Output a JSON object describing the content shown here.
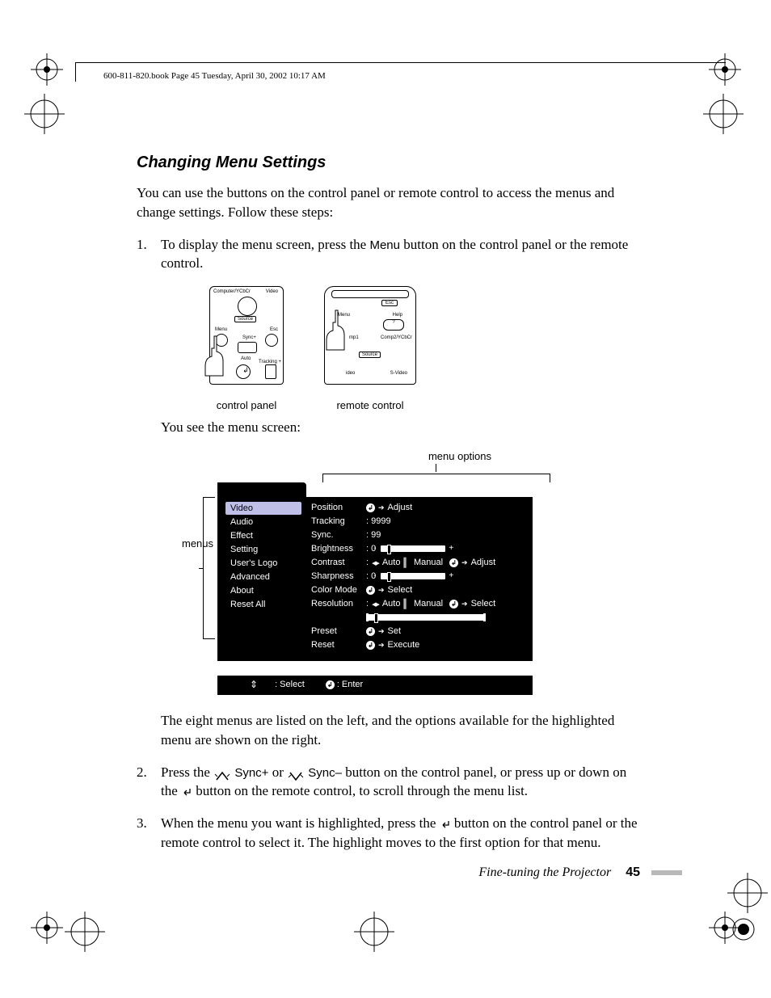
{
  "header": "600-811-820.book  Page 45  Tuesday, April 30, 2002  10:17 AM",
  "title": "Changing Menu Settings",
  "intro": "You can use the buttons on the control panel or remote control to access the menus and change settings. Follow these steps:",
  "step1_a": "To display the menu screen, press the ",
  "step1_menu": "Menu",
  "step1_b": " button on the control panel or the remote control.",
  "caption_cp": "control panel",
  "caption_rc": "remote control",
  "you_see": "You see the menu screen:",
  "label_menus": "menus",
  "label_options": "menu options",
  "menu": {
    "left": [
      "Video",
      "Audio",
      "Effect",
      "Setting",
      "User's Logo",
      "Advanced",
      "About",
      "Reset All"
    ],
    "rows": [
      {
        "lbl": "Position",
        "type": "action",
        "text": "Adjust"
      },
      {
        "lbl": "Tracking",
        "type": "value",
        "text": ": 9999"
      },
      {
        "lbl": "Sync.",
        "type": "value",
        "text": ":   99"
      },
      {
        "lbl": "Brightness",
        "type": "slider",
        "text": ":   0"
      },
      {
        "lbl": "Contrast",
        "type": "automanual",
        "text": "Adjust"
      },
      {
        "lbl": "Sharpness",
        "type": "slider",
        "text": ":   0"
      },
      {
        "lbl": "Color Mode",
        "type": "action",
        "text": "Select"
      },
      {
        "lbl": "Resolution",
        "type": "automanual",
        "text": "Select"
      },
      {
        "lbl": "",
        "type": "widebar",
        "text": ""
      },
      {
        "lbl": "Preset",
        "type": "action",
        "text": "Set"
      },
      {
        "lbl": "Reset",
        "type": "action",
        "text": "Execute"
      }
    ],
    "automanual_prefix": ":",
    "auto_txt": "Auto",
    "manual_txt": "Manual",
    "footer_select": ": Select",
    "footer_enter": ": Enter"
  },
  "para2": "The eight menus are listed on the left, and the options available for the highlighted menu are shown on the right.",
  "step2_a": "Press the ",
  "step2_sync_plus": " Sync+",
  "step2_or": " or ",
  "step2_sync_minus": " Sync–",
  "step2_b": " button on the control panel, or press up or down on the ",
  "step2_c": " button on the remote control, to scroll through the menu list.",
  "step3_a": "When the menu you want is highlighted, press the ",
  "step3_b": " button on the control panel or the remote control to select it. The highlight moves to the first option for that menu.",
  "footer_title": "Fine-tuning the Projector",
  "page_number": "45",
  "panel": {
    "cp": {
      "top_l": "Computer/YCbCr",
      "top_r": "Video",
      "source": "Source",
      "menu": "Menu",
      "esc": "Esc",
      "syncp": "Sync+",
      "auto": "Auto",
      "track": "Tracking +"
    },
    "rc": {
      "esc": "Esc",
      "menu": "Menu",
      "help": "Help",
      "mp1": "mp1",
      "comp2": "Comp2/YCbCr",
      "source": "Source",
      "ideo": "ideo",
      "svideo": "S-Video"
    }
  }
}
